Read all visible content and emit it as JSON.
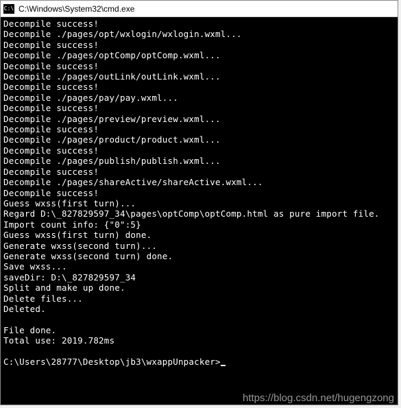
{
  "window": {
    "title": "C:\\Windows\\System32\\cmd.exe",
    "icon_label": "C:\\"
  },
  "terminal": {
    "lines": [
      "Decompile success!",
      "Decompile ./pages/opt/wxlogin/wxlogin.wxml...",
      "Decompile success!",
      "Decompile ./pages/optComp/optComp.wxml...",
      "Decompile success!",
      "Decompile ./pages/outLink/outLink.wxml...",
      "Decompile success!",
      "Decompile ./pages/pay/pay.wxml...",
      "Decompile success!",
      "Decompile ./pages/preview/preview.wxml...",
      "Decompile success!",
      "Decompile ./pages/product/product.wxml...",
      "Decompile success!",
      "Decompile ./pages/publish/publish.wxml...",
      "Decompile success!",
      "Decompile ./pages/shareActive/shareActive.wxml...",
      "Decompile success!",
      "Guess wxss(first turn)...",
      "Regard D:\\_827829597_34\\pages\\optComp\\optComp.html as pure import file.",
      "Import count info: {\"0\":5}",
      "Guess wxss(first turn) done.",
      "Generate wxss(second turn)...",
      "Generate wxss(second turn) done.",
      "Save wxss...",
      "saveDir: D:\\_827829597_34",
      "Split and make up done.",
      "Delete files...",
      "Deleted.",
      "",
      "File done.",
      "Total use: 2019.782ms",
      "",
      "C:\\Users\\28777\\Desktop\\jb3\\wxappUnpacker>"
    ]
  },
  "watermark": "https://blog.csdn.net/hugengzong"
}
